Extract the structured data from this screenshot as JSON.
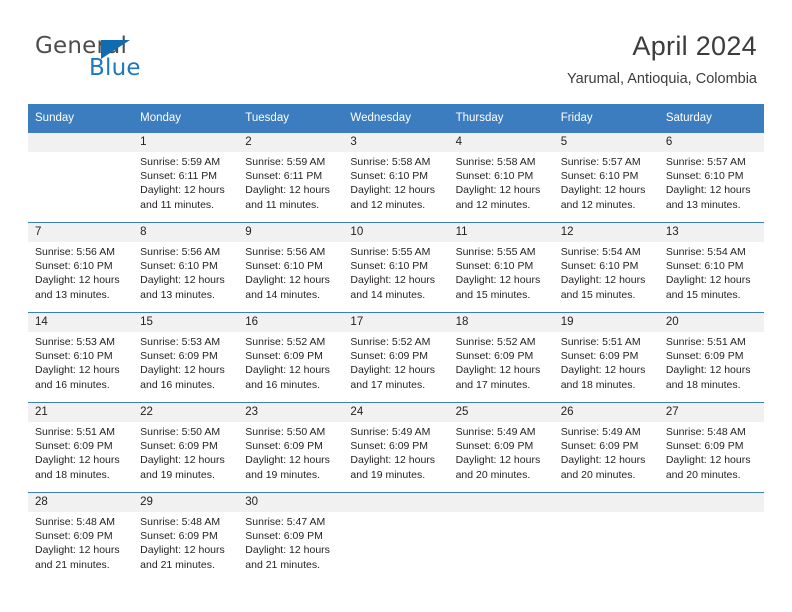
{
  "logo": {
    "word1": "General",
    "word2": "Blue",
    "triangle_color": "#0f6cb0",
    "blue": "#1f77bd"
  },
  "header": {
    "title": "April 2024",
    "location": "Yarumal, Antioquia, Colombia"
  },
  "theme": {
    "header_blue": "#3b7dbf",
    "daynum_band": "#f1f1f1",
    "text": "#231f20"
  },
  "weekday_headers": [
    "Sunday",
    "Monday",
    "Tuesday",
    "Wednesday",
    "Thursday",
    "Friday",
    "Saturday"
  ],
  "weeks": [
    [
      {
        "day": "",
        "lines": []
      },
      {
        "day": "1",
        "lines": [
          "Sunrise: 5:59 AM",
          "Sunset: 6:11 PM",
          "Daylight: 12 hours",
          "and 11 minutes."
        ]
      },
      {
        "day": "2",
        "lines": [
          "Sunrise: 5:59 AM",
          "Sunset: 6:11 PM",
          "Daylight: 12 hours",
          "and 11 minutes."
        ]
      },
      {
        "day": "3",
        "lines": [
          "Sunrise: 5:58 AM",
          "Sunset: 6:10 PM",
          "Daylight: 12 hours",
          "and 12 minutes."
        ]
      },
      {
        "day": "4",
        "lines": [
          "Sunrise: 5:58 AM",
          "Sunset: 6:10 PM",
          "Daylight: 12 hours",
          "and 12 minutes."
        ]
      },
      {
        "day": "5",
        "lines": [
          "Sunrise: 5:57 AM",
          "Sunset: 6:10 PM",
          "Daylight: 12 hours",
          "and 12 minutes."
        ]
      },
      {
        "day": "6",
        "lines": [
          "Sunrise: 5:57 AM",
          "Sunset: 6:10 PM",
          "Daylight: 12 hours",
          "and 13 minutes."
        ]
      }
    ],
    [
      {
        "day": "7",
        "lines": [
          "Sunrise: 5:56 AM",
          "Sunset: 6:10 PM",
          "Daylight: 12 hours",
          "and 13 minutes."
        ]
      },
      {
        "day": "8",
        "lines": [
          "Sunrise: 5:56 AM",
          "Sunset: 6:10 PM",
          "Daylight: 12 hours",
          "and 13 minutes."
        ]
      },
      {
        "day": "9",
        "lines": [
          "Sunrise: 5:56 AM",
          "Sunset: 6:10 PM",
          "Daylight: 12 hours",
          "and 14 minutes."
        ]
      },
      {
        "day": "10",
        "lines": [
          "Sunrise: 5:55 AM",
          "Sunset: 6:10 PM",
          "Daylight: 12 hours",
          "and 14 minutes."
        ]
      },
      {
        "day": "11",
        "lines": [
          "Sunrise: 5:55 AM",
          "Sunset: 6:10 PM",
          "Daylight: 12 hours",
          "and 15 minutes."
        ]
      },
      {
        "day": "12",
        "lines": [
          "Sunrise: 5:54 AM",
          "Sunset: 6:10 PM",
          "Daylight: 12 hours",
          "and 15 minutes."
        ]
      },
      {
        "day": "13",
        "lines": [
          "Sunrise: 5:54 AM",
          "Sunset: 6:10 PM",
          "Daylight: 12 hours",
          "and 15 minutes."
        ]
      }
    ],
    [
      {
        "day": "14",
        "lines": [
          "Sunrise: 5:53 AM",
          "Sunset: 6:10 PM",
          "Daylight: 12 hours",
          "and 16 minutes."
        ]
      },
      {
        "day": "15",
        "lines": [
          "Sunrise: 5:53 AM",
          "Sunset: 6:09 PM",
          "Daylight: 12 hours",
          "and 16 minutes."
        ]
      },
      {
        "day": "16",
        "lines": [
          "Sunrise: 5:52 AM",
          "Sunset: 6:09 PM",
          "Daylight: 12 hours",
          "and 16 minutes."
        ]
      },
      {
        "day": "17",
        "lines": [
          "Sunrise: 5:52 AM",
          "Sunset: 6:09 PM",
          "Daylight: 12 hours",
          "and 17 minutes."
        ]
      },
      {
        "day": "18",
        "lines": [
          "Sunrise: 5:52 AM",
          "Sunset: 6:09 PM",
          "Daylight: 12 hours",
          "and 17 minutes."
        ]
      },
      {
        "day": "19",
        "lines": [
          "Sunrise: 5:51 AM",
          "Sunset: 6:09 PM",
          "Daylight: 12 hours",
          "and 18 minutes."
        ]
      },
      {
        "day": "20",
        "lines": [
          "Sunrise: 5:51 AM",
          "Sunset: 6:09 PM",
          "Daylight: 12 hours",
          "and 18 minutes."
        ]
      }
    ],
    [
      {
        "day": "21",
        "lines": [
          "Sunrise: 5:51 AM",
          "Sunset: 6:09 PM",
          "Daylight: 12 hours",
          "and 18 minutes."
        ]
      },
      {
        "day": "22",
        "lines": [
          "Sunrise: 5:50 AM",
          "Sunset: 6:09 PM",
          "Daylight: 12 hours",
          "and 19 minutes."
        ]
      },
      {
        "day": "23",
        "lines": [
          "Sunrise: 5:50 AM",
          "Sunset: 6:09 PM",
          "Daylight: 12 hours",
          "and 19 minutes."
        ]
      },
      {
        "day": "24",
        "lines": [
          "Sunrise: 5:49 AM",
          "Sunset: 6:09 PM",
          "Daylight: 12 hours",
          "and 19 minutes."
        ]
      },
      {
        "day": "25",
        "lines": [
          "Sunrise: 5:49 AM",
          "Sunset: 6:09 PM",
          "Daylight: 12 hours",
          "and 20 minutes."
        ]
      },
      {
        "day": "26",
        "lines": [
          "Sunrise: 5:49 AM",
          "Sunset: 6:09 PM",
          "Daylight: 12 hours",
          "and 20 minutes."
        ]
      },
      {
        "day": "27",
        "lines": [
          "Sunrise: 5:48 AM",
          "Sunset: 6:09 PM",
          "Daylight: 12 hours",
          "and 20 minutes."
        ]
      }
    ],
    [
      {
        "day": "28",
        "lines": [
          "Sunrise: 5:48 AM",
          "Sunset: 6:09 PM",
          "Daylight: 12 hours",
          "and 21 minutes."
        ]
      },
      {
        "day": "29",
        "lines": [
          "Sunrise: 5:48 AM",
          "Sunset: 6:09 PM",
          "Daylight: 12 hours",
          "and 21 minutes."
        ]
      },
      {
        "day": "30",
        "lines": [
          "Sunrise: 5:47 AM",
          "Sunset: 6:09 PM",
          "Daylight: 12 hours",
          "and 21 minutes."
        ]
      },
      {
        "day": "",
        "lines": []
      },
      {
        "day": "",
        "lines": []
      },
      {
        "day": "",
        "lines": []
      },
      {
        "day": "",
        "lines": []
      }
    ]
  ]
}
